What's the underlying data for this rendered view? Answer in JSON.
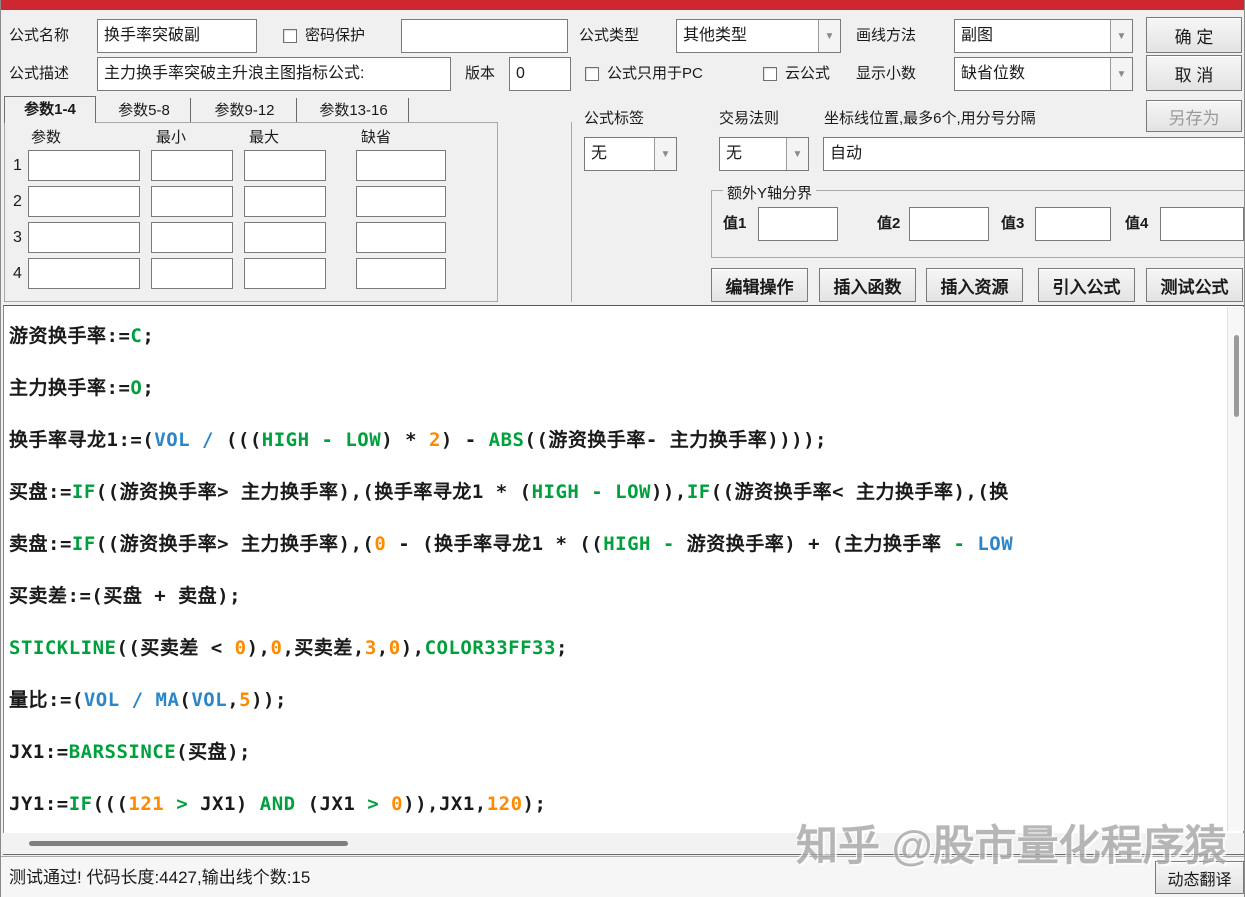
{
  "window": {
    "titlebar_color": "#cf2731"
  },
  "form": {
    "name_label": "公式名称",
    "name_value": "换手率突破副",
    "password_label": "密码保护",
    "password_value": "",
    "desc_label": "公式描述",
    "desc_value": "主力换手率突破主升浪主图指标公式:",
    "version_label": "版本",
    "version_value": "0",
    "type_label": "公式类型",
    "type_value": "其他类型",
    "draw_label": "画线方法",
    "draw_value": "副图",
    "pc_only_label": "公式只用于PC",
    "cloud_label": "云公式",
    "decimal_label": "显示小数",
    "decimal_value": "缺省位数",
    "ok_label": "确 定",
    "cancel_label": "取 消",
    "save_as_label": "另存为"
  },
  "params": {
    "tabs": [
      "参数1-4",
      "参数5-8",
      "参数9-12",
      "参数13-16"
    ],
    "headers": [
      "参数",
      "最小",
      "最大",
      "缺省"
    ],
    "rows": [
      "1",
      "2",
      "3",
      "4"
    ]
  },
  "middle": {
    "tag_label": "公式标签",
    "tag_value": "无",
    "rule_label": "交易法则",
    "rule_value": "无",
    "coord_label": "坐标线位置,最多6个,用分号分隔",
    "coord_value": "自动",
    "y_axis_group": "额外Y轴分界",
    "value_labels": [
      "值1",
      "值2",
      "值3",
      "值4"
    ],
    "buttons": [
      "编辑操作",
      "插入函数",
      "插入资源",
      "引入公式",
      "测试公式"
    ]
  },
  "code": {
    "syntax_colors": {
      "keyword_green": "#00a13c",
      "function_blue": "#2b85c8",
      "number_orange": "#ff8a00",
      "text_black": "#1a1a1a"
    },
    "lines": [
      [
        {
          "t": "游资换手率:=",
          "c": "k"
        },
        {
          "t": "C",
          "c": "g"
        },
        {
          "t": ";",
          "c": "k"
        }
      ],
      [
        {
          "t": "主力换手率:=",
          "c": "k"
        },
        {
          "t": "O",
          "c": "g"
        },
        {
          "t": ";",
          "c": "k"
        }
      ],
      [
        {
          "t": "换手率寻龙1:=(",
          "c": "k"
        },
        {
          "t": "VOL",
          "c": "b"
        },
        {
          "t": " ",
          "c": "k"
        },
        {
          "t": "/",
          "c": "b"
        },
        {
          "t": " (((",
          "c": "k"
        },
        {
          "t": "HIGH",
          "c": "g"
        },
        {
          "t": " - ",
          "c": "g"
        },
        {
          "t": "LOW",
          "c": "g"
        },
        {
          "t": ") * ",
          "c": "k"
        },
        {
          "t": "2",
          "c": "o"
        },
        {
          "t": ") - ",
          "c": "k"
        },
        {
          "t": "ABS",
          "c": "g"
        },
        {
          "t": "((游资换手率- 主力换手率))));",
          "c": "k"
        }
      ],
      [
        {
          "t": "买盘:=",
          "c": "k"
        },
        {
          "t": "IF",
          "c": "g"
        },
        {
          "t": "((游资换手率> 主力换手率),(换手率寻龙1 * (",
          "c": "k"
        },
        {
          "t": "HIGH",
          "c": "g"
        },
        {
          "t": " - ",
          "c": "g"
        },
        {
          "t": "LOW",
          "c": "g"
        },
        {
          "t": ")),",
          "c": "k"
        },
        {
          "t": "IF",
          "c": "g"
        },
        {
          "t": "((游资换手率< 主力换手率),(换",
          "c": "k"
        }
      ],
      [
        {
          "t": "卖盘:=",
          "c": "k"
        },
        {
          "t": "IF",
          "c": "g"
        },
        {
          "t": "((游资换手率> 主力换手率),(",
          "c": "k"
        },
        {
          "t": "0",
          "c": "o"
        },
        {
          "t": " - (换手率寻龙1 * ((",
          "c": "k"
        },
        {
          "t": "HIGH",
          "c": "g"
        },
        {
          "t": " - ",
          "c": "g"
        },
        {
          "t": "游资换手率) + (主力换手率 ",
          "c": "k"
        },
        {
          "t": "- ",
          "c": "g"
        },
        {
          "t": "LOW",
          "c": "b"
        }
      ],
      [
        {
          "t": "买卖差:=(买盘 + 卖盘);",
          "c": "k"
        }
      ],
      [
        {
          "t": "STICKLINE",
          "c": "g"
        },
        {
          "t": "((买卖差 < ",
          "c": "k"
        },
        {
          "t": "0",
          "c": "o"
        },
        {
          "t": "),",
          "c": "k"
        },
        {
          "t": "0",
          "c": "o"
        },
        {
          "t": ",买卖差,",
          "c": "k"
        },
        {
          "t": "3",
          "c": "o"
        },
        {
          "t": ",",
          "c": "k"
        },
        {
          "t": "0",
          "c": "o"
        },
        {
          "t": "),",
          "c": "k"
        },
        {
          "t": "COLOR33FF33",
          "c": "g"
        },
        {
          "t": ";",
          "c": "k"
        }
      ],
      [
        {
          "t": "量比:=(",
          "c": "k"
        },
        {
          "t": "VOL",
          "c": "b"
        },
        {
          "t": " ",
          "c": "k"
        },
        {
          "t": "/",
          "c": "b"
        },
        {
          "t": " ",
          "c": "k"
        },
        {
          "t": "MA",
          "c": "b"
        },
        {
          "t": "(",
          "c": "k"
        },
        {
          "t": "VOL",
          "c": "b"
        },
        {
          "t": ",",
          "c": "k"
        },
        {
          "t": "5",
          "c": "o"
        },
        {
          "t": "));",
          "c": "k"
        }
      ],
      [
        {
          "t": "JX1:=",
          "c": "k"
        },
        {
          "t": "BARSSINCE",
          "c": "g"
        },
        {
          "t": "(买盘);",
          "c": "k"
        }
      ],
      [
        {
          "t": "JY1:=",
          "c": "k"
        },
        {
          "t": "IF",
          "c": "g"
        },
        {
          "t": "(((",
          "c": "k"
        },
        {
          "t": "121",
          "c": "o"
        },
        {
          "t": " ",
          "c": "k"
        },
        {
          "t": ">",
          "c": "g"
        },
        {
          "t": " JX1) ",
          "c": "k"
        },
        {
          "t": "AND",
          "c": "g"
        },
        {
          "t": " (JX1 ",
          "c": "k"
        },
        {
          "t": ">",
          "c": "g"
        },
        {
          "t": " ",
          "c": "k"
        },
        {
          "t": "0",
          "c": "o"
        },
        {
          "t": ")),JX1,",
          "c": "k"
        },
        {
          "t": "120",
          "c": "o"
        },
        {
          "t": ");",
          "c": "k"
        }
      ]
    ]
  },
  "statusbar": {
    "text": "测试通过! 代码长度:4427,输出线个数:15",
    "translate_button": "动态翻译"
  },
  "watermark": "知乎 @股市量化程序猿"
}
